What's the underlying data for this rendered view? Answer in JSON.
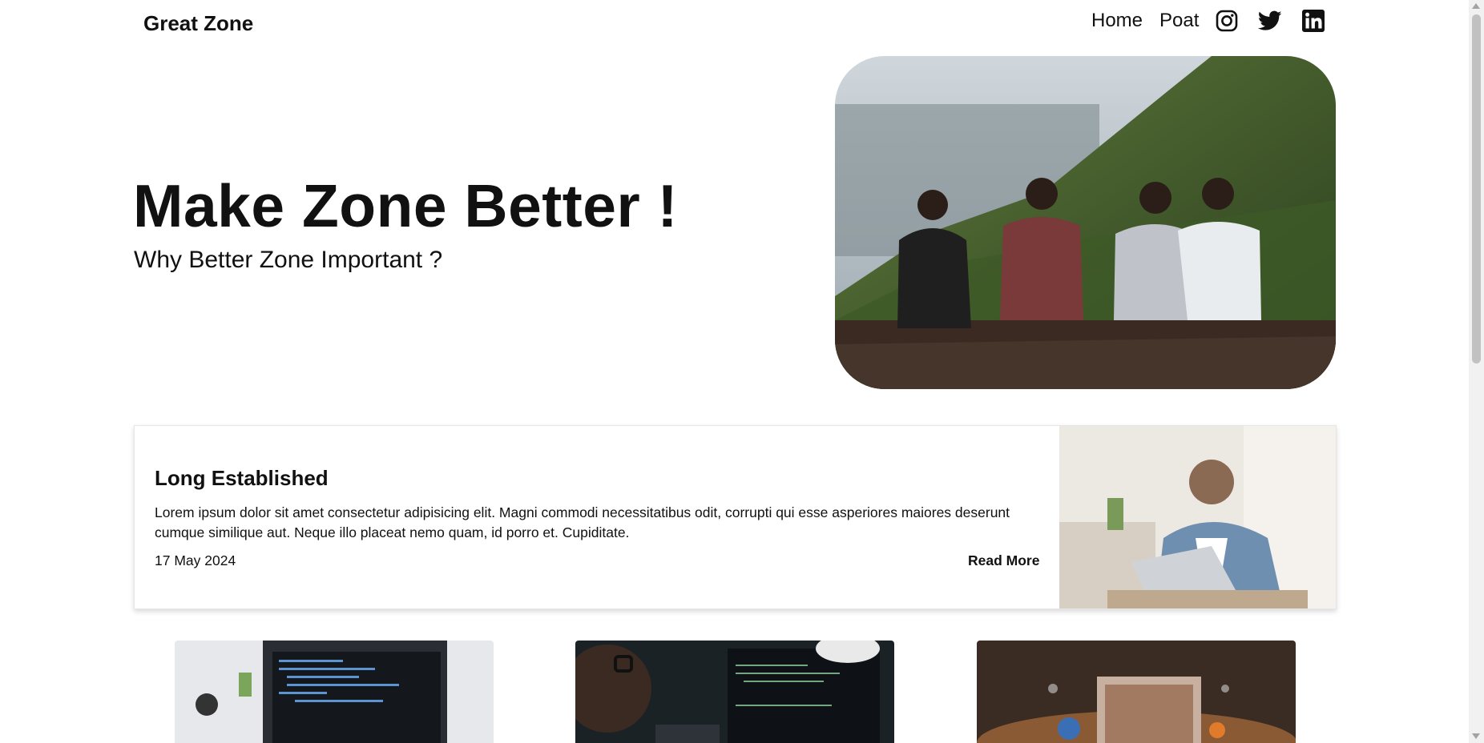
{
  "header": {
    "brand": "Great Zone",
    "nav": [
      {
        "label": "Home"
      },
      {
        "label": "Poat"
      }
    ],
    "social": [
      "instagram-icon",
      "twitter-icon",
      "linkedin-icon"
    ]
  },
  "hero": {
    "title": "Make Zone Better !",
    "subtitle": "Why Better Zone Important ?",
    "image": "group-of-four-friends-on-hillside"
  },
  "featured": {
    "title": "Long Established",
    "text": "Lorem ipsum dolor sit amet consectetur adipisicing elit. Magni commodi necessitatibus odit, corrupti qui esse asperiores maiores deserunt cumque similique aut. Neque illo placeat nemo quam, id porro et. Cupiditate.",
    "date": "17 May 2024",
    "read_more": "Read More",
    "image": "smiling-man-with-laptop"
  },
  "cards": [
    {
      "image": "laptop-with-code"
    },
    {
      "image": "developer-with-code-screens"
    },
    {
      "image": "laptop-with-3d-shapes"
    }
  ],
  "colors": {
    "text": "#111111",
    "background": "#ffffff",
    "card_border": "#e6e6e6"
  }
}
